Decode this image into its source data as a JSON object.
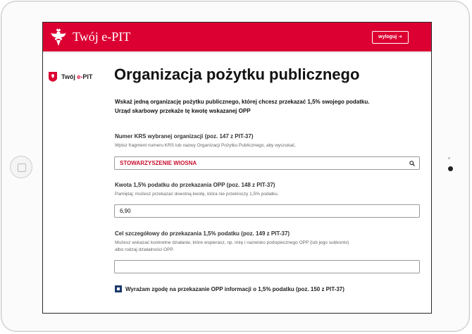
{
  "header": {
    "brand": "Twój e-PIT",
    "logout_label": "wyloguj ➔"
  },
  "sidebar": {
    "logo_text_prefix": "Twój ",
    "logo_text_accent": "e-",
    "logo_text_suffix": "PIT"
  },
  "page": {
    "title": "Organizacja pożytku publicznego",
    "intro_line1": "Wskaż jedną organizację pożytku publicznego, której chcesz przekazać 1,5% swojego podatku.",
    "intro_line2": "Urząd skarbowy przekaże tę kwotę wskazanej OPP"
  },
  "form": {
    "krs": {
      "label": "Numer KRS wybranej organizacji (poz. 147 z PIT-37)",
      "hint": "Wpisz fragment numeru KRS lub nazwy Organizacji Pożytku Publicznego, aby wyszukać.",
      "value": "STOWARZYSZENIE WIOSNA"
    },
    "amount": {
      "label": "Kwota 1,5% podatku do przekazania OPP (poz. 148 z PIT-37)",
      "hint": "Pamiętaj: możesz przekazać dowolną kwotę, która nie przekroczy 1,5% podatku.",
      "value": "6,90"
    },
    "purpose": {
      "label": "Cel szczegółowy do przekazania 1,5% podatku (poz. 149 z PIT-37)",
      "hint_line1": "Możesz wskazać konkretne działanie, które wspierasz, np. imię i nazwisko podopiecznego OPP (lub jego subkonto)",
      "hint_line2": "albo rodzaj działalności OPP.",
      "value": ""
    },
    "consent": {
      "label": "Wyrażam zgodę na przekazanie OPP informacji o 1,5% podatku (poz. 150 z PIT-37)",
      "checked": true
    }
  },
  "colors": {
    "brand_red": "#dc0032",
    "checkbox_blue": "#1b3a6b"
  }
}
